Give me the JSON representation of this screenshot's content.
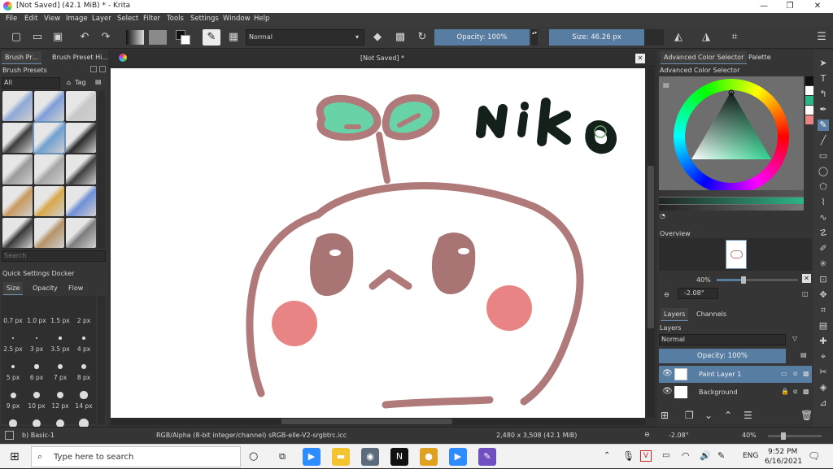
{
  "window": {
    "title": "[Not Saved]  (42.1 MiB)  * - Krita",
    "minimize_glyph": "—",
    "maximize_glyph": "❐",
    "close_glyph": "✕"
  },
  "menu": [
    "File",
    "Edit",
    "View",
    "Image",
    "Layer",
    "Select",
    "Filter",
    "Tools",
    "Settings",
    "Window",
    "Help"
  ],
  "toolbar": {
    "blend_mode": "Normal",
    "opacity_label": "Opacity: 100%",
    "size_label": "Size: 46.26 px",
    "dropdown_glyph": "▾"
  },
  "left_panel": {
    "tabs": [
      "Brush Pr...",
      "Brush Preset Hi..."
    ],
    "brush_presets_title": "Brush Presets",
    "filter_value": "All",
    "tag_label": "Tag",
    "search_placeholder": "Search",
    "quick_settings_title": "Quick Settings Docker",
    "quick_tabs": [
      "Size",
      "Opacity",
      "Flow"
    ],
    "size_rows": [
      [
        "0.7 px",
        "1.0 px",
        "1.5 px",
        "2 px"
      ],
      [
        "2.5 px",
        "3 px",
        "3.5 px",
        "4 px"
      ],
      [
        "5 px",
        "6 px",
        "7 px",
        "8 px"
      ],
      [
        "9 px",
        "10 px",
        "12 px",
        "14 px"
      ]
    ],
    "brush_colors": [
      [
        "#8fa9d6",
        "#7e9ed9",
        "#c8c8c8"
      ],
      [
        "#3d3d3d",
        "#6fa0d0",
        "#2c2c2c"
      ],
      [
        "#9a9a9a",
        "#a6a6a6",
        "#404040"
      ],
      [
        "#c89a60",
        "#d8a84a",
        "#6e8fd8"
      ],
      [
        "#3a3a3a",
        "#b59468",
        "#7d7d7d"
      ]
    ]
  },
  "canvas_view": {
    "document_tab": "[Not Saved]  *",
    "close_glyph": "✕",
    "drawing_text": "NiKo"
  },
  "colors": {
    "outline": "#b07a7a",
    "leaf": "#69d3a8",
    "cheek": "#e88484",
    "eye": "#a87474",
    "ink": "#14201a",
    "accent": "#587da2"
  },
  "right_panel": {
    "tabs": [
      "Advanced Color Selector",
      "Palette"
    ],
    "color_selector_title": "Advanced Color Selector",
    "overview_title": "Overview",
    "zoom_value": "40%",
    "rotation_value": "-2.08°",
    "layer_tabs": [
      "Layers",
      "Channels"
    ],
    "layers_title": "Layers",
    "blend_mode": "Normal",
    "opacity_label": "Opacity:  100%",
    "layers": [
      {
        "name": "Paint Layer 1",
        "selected": true
      },
      {
        "name": "Background",
        "selected": false
      }
    ],
    "swatches": [
      "#111111",
      "#ffffff",
      "#2db58a",
      "#ffffff",
      "#e88484"
    ]
  },
  "status": {
    "brush": "b) Basic-1",
    "color_space": "RGB/Alpha (8-bit integer/channel)  sRGB-elle-V2-srgbtrc.icc",
    "dimensions": "2,480 x 3,508 (42.1 MiB)",
    "rotation": "-2.08°",
    "zoom": "40%"
  },
  "taskbar": {
    "search_placeholder": "Type here to search",
    "time": "9:52 PM",
    "date": "6/16/2021",
    "language": "ENG",
    "apps": [
      {
        "name": "task-view",
        "glyph": "⧉",
        "color": "#f2f2f2"
      },
      {
        "name": "zoom-meetings",
        "glyph": "▶",
        "color": "#2d8cff"
      },
      {
        "name": "file-explorer",
        "glyph": "▬",
        "color": "#f4c430"
      },
      {
        "name": "camera",
        "glyph": "◉",
        "color": "#5b6b7b"
      },
      {
        "name": "netflix",
        "glyph": "N",
        "color": "#111111"
      },
      {
        "name": "chrome",
        "glyph": "●",
        "color": "#e0a020"
      },
      {
        "name": "zoom",
        "glyph": "▶",
        "color": "#2d8cff"
      },
      {
        "name": "krita",
        "glyph": "✎",
        "color": "#7050c0"
      }
    ]
  }
}
